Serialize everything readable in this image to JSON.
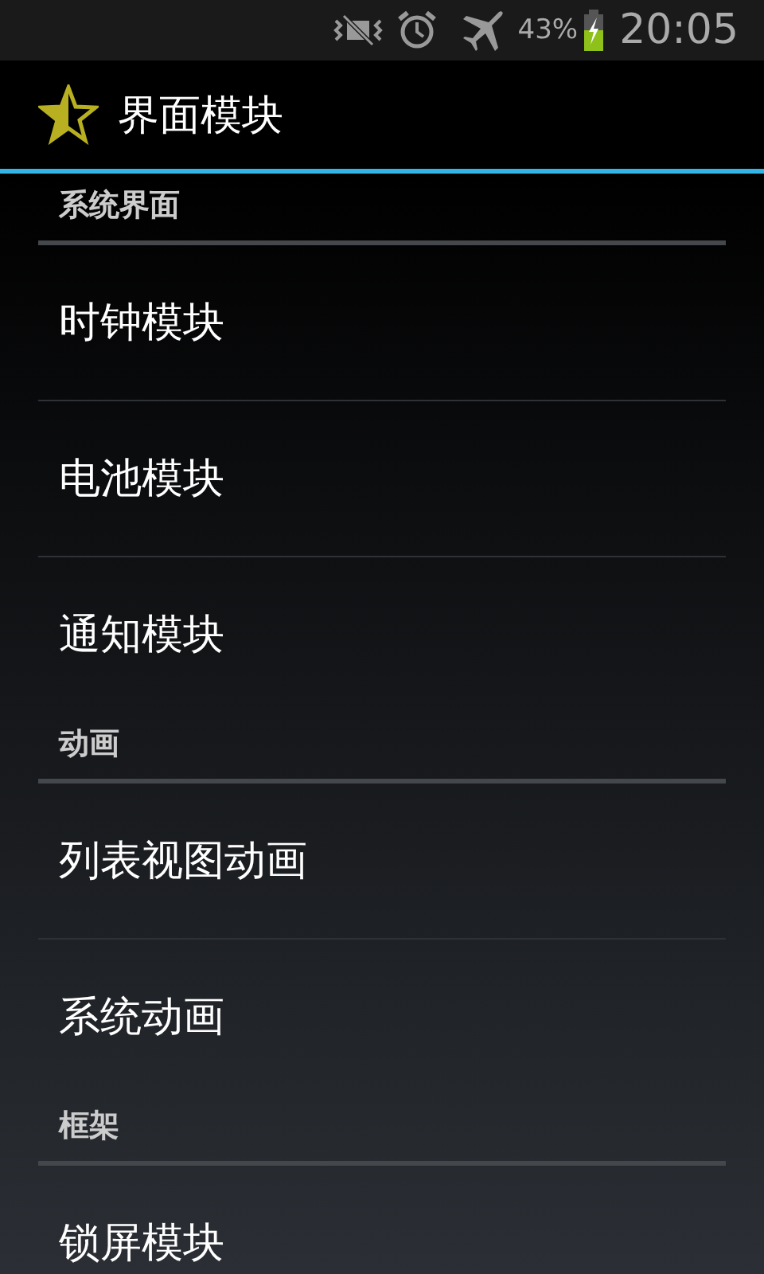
{
  "status_bar": {
    "battery": "43%",
    "time": "20:05"
  },
  "action_bar": {
    "title": "界面模块"
  },
  "sections": [
    {
      "title": "系统界面",
      "items": [
        "时钟模块",
        "电池模块",
        "通知模块"
      ]
    },
    {
      "title": "动画",
      "items": [
        "列表视图动画",
        "系统动画"
      ]
    },
    {
      "title": "框架",
      "items": [
        "锁屏模块"
      ]
    }
  ]
}
